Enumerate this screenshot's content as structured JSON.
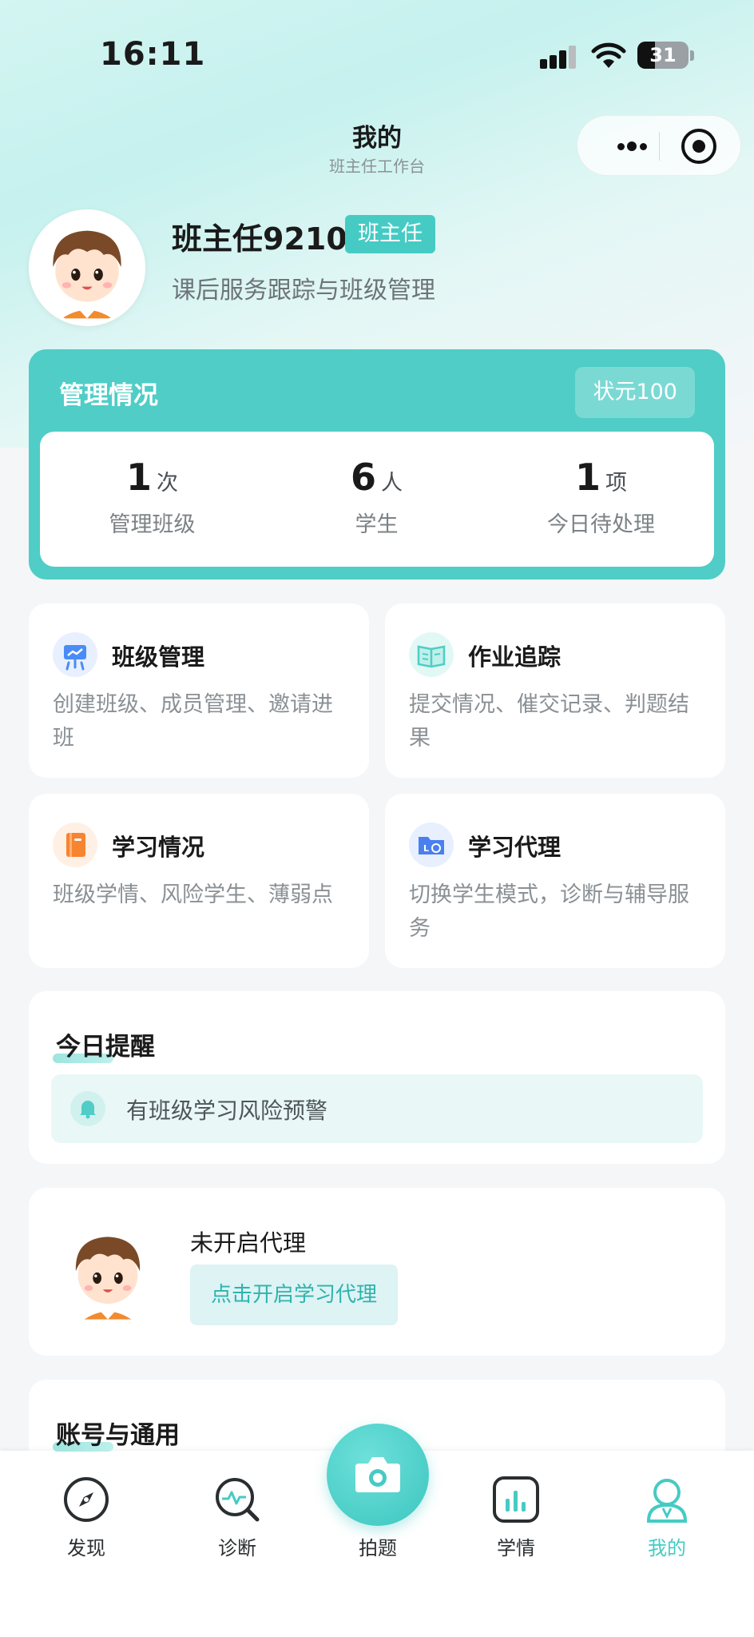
{
  "status_bar": {
    "time": "16:11",
    "battery": "31"
  },
  "nav": {
    "title": "我的",
    "subtitle": "班主任工作台"
  },
  "profile": {
    "name": "班主任9210",
    "role": "班主任",
    "description": "课后服务跟踪与班级管理"
  },
  "management": {
    "title": "管理情况",
    "badge": "状元100",
    "stats": [
      {
        "value": "1",
        "unit": "次",
        "label": "管理班级"
      },
      {
        "value": "6",
        "unit": "人",
        "label": "学生"
      },
      {
        "value": "1",
        "unit": "项",
        "label": "今日待处理"
      }
    ]
  },
  "features": [
    {
      "title": "班级管理",
      "desc": "创建班级、成员管理、邀请进班",
      "icon": "class-board-icon"
    },
    {
      "title": "作业追踪",
      "desc": "提交情况、催交记录、判题结果",
      "icon": "book-icon"
    },
    {
      "title": "学习情况",
      "desc": "班级学情、风险学生、薄弱点",
      "icon": "notebook-icon"
    },
    {
      "title": "学习代理",
      "desc": "切换学生模式，诊断与辅导服务",
      "icon": "folder-icon"
    }
  ],
  "reminder": {
    "title": "今日提醒",
    "item": "有班级学习风险预警"
  },
  "agent": {
    "status": "未开启代理",
    "button": "点击开启学习代理"
  },
  "account": {
    "title": "账号与通用"
  },
  "tabs": [
    {
      "label": "发现",
      "icon": "compass-icon"
    },
    {
      "label": "诊断",
      "icon": "diagnose-icon"
    },
    {
      "label": "拍题",
      "icon": "camera-icon"
    },
    {
      "label": "学情",
      "icon": "chart-icon"
    },
    {
      "label": "我的",
      "icon": "user-icon"
    }
  ],
  "colors": {
    "accent": "#45cbc4",
    "accent_card": "#4fcdc6"
  }
}
